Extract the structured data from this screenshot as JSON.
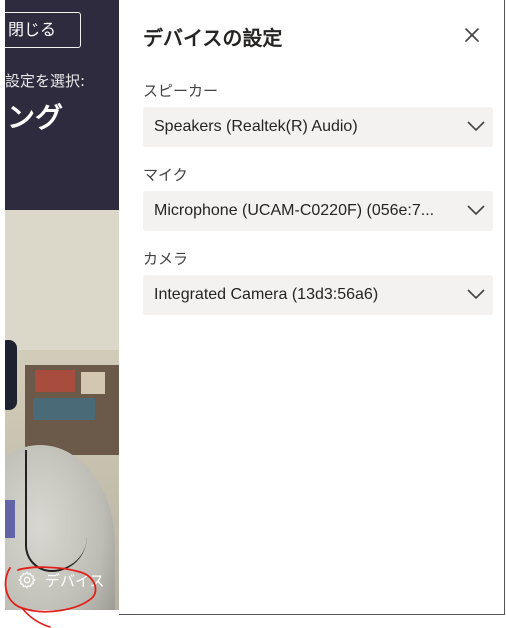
{
  "background_meeting": {
    "close_button_label": "閉じる",
    "choose_text": "設定を選択:",
    "title_partial": "ング",
    "device_button_label": "デバイス"
  },
  "panel": {
    "title": "デバイスの設定",
    "close_icon": "close-icon",
    "speaker": {
      "label": "スピーカー",
      "value": "Speakers (Realtek(R) Audio)"
    },
    "microphone": {
      "label": "マイク",
      "value": "Microphone (UCAM-C0220F) (056e:7..."
    },
    "camera": {
      "label": "カメラ",
      "value": "Integrated Camera (13d3:56a6)"
    }
  },
  "colors": {
    "left_pane_bg": "#2e2b3f",
    "select_bg": "#f3f2f1",
    "annotation_red": "#e0201a",
    "teams_purple": "#6264a7"
  }
}
